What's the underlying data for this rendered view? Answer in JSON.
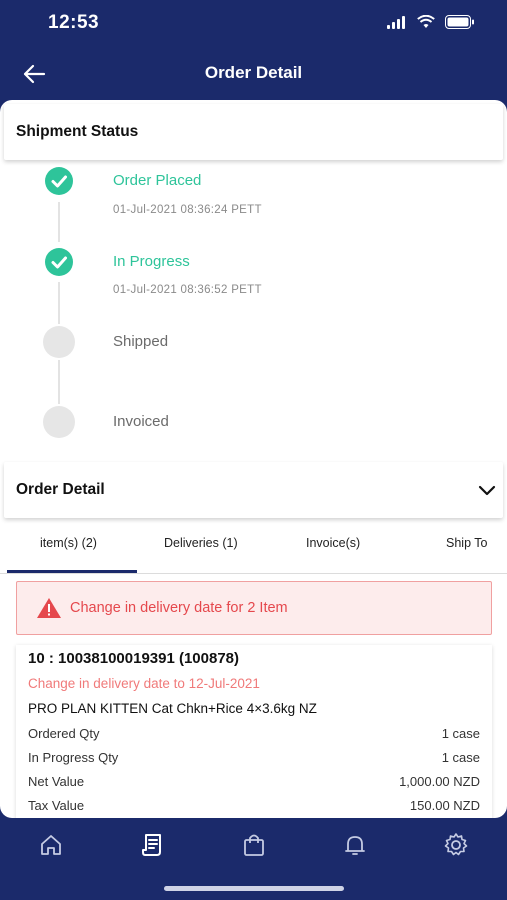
{
  "status_bar": {
    "time": "12:53"
  },
  "header": {
    "title": "Order Detail"
  },
  "shipment": {
    "title": "Shipment Status",
    "steps": [
      {
        "label": "Order Placed",
        "time": "01-Jul-2021 08:36:24 PETT",
        "state": "done"
      },
      {
        "label": "In Progress",
        "time": "01-Jul-2021 08:36:52 PETT",
        "state": "done"
      },
      {
        "label": "Shipped",
        "time": "",
        "state": "pending"
      },
      {
        "label": "Invoiced",
        "time": "",
        "state": "pending"
      }
    ]
  },
  "order_detail": {
    "title": "Order Detail"
  },
  "tabs": [
    {
      "label": "item(s) (2)",
      "active": true
    },
    {
      "label": "Deliveries (1)",
      "active": false
    },
    {
      "label": "Invoice(s)",
      "active": false
    },
    {
      "label": "Ship To",
      "active": false
    }
  ],
  "alert": {
    "text": "Change in delivery date for 2 Item"
  },
  "item": {
    "id": "10 : 10038100019391 (100878)",
    "change_note": "Change in delivery date to 12-Jul-2021",
    "name": "PRO PLAN KITTEN Cat Chkn+Rice 4×3.6kg NZ",
    "rows": [
      {
        "label": "Ordered Qty",
        "value": "1 case"
      },
      {
        "label": "In Progress Qty",
        "value": "1 case"
      },
      {
        "label": "Net Value",
        "value": "1,000.00 NZD"
      },
      {
        "label": "Tax Value",
        "value": "150.00 NZD"
      }
    ]
  },
  "bottom_nav": [
    "home-icon",
    "orders-icon",
    "shopping-bag-icon",
    "bell-icon",
    "settings-icon"
  ],
  "colors": {
    "primary": "#1b2a6b",
    "success": "#2ec49a",
    "alert": "#e5484d",
    "alert_bg": "#fdecec"
  }
}
